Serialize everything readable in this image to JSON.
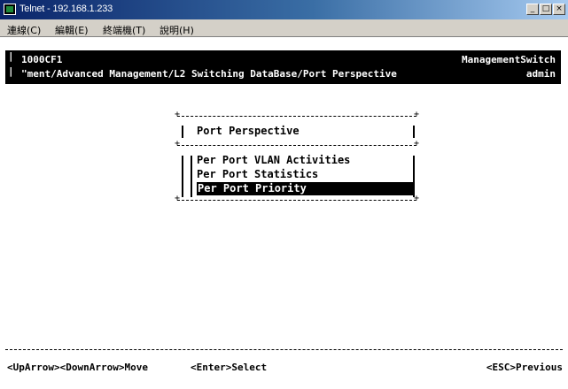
{
  "window": {
    "title": "Telnet - 192.168.1.233",
    "controls": [
      "_",
      "□",
      "×"
    ]
  },
  "menubar": {
    "items": [
      "連線(C)",
      "編輯(E)",
      "終端機(T)",
      "說明(H)"
    ]
  },
  "terminal": {
    "header": {
      "device_id": "1000CF1",
      "product": "ManagementSwitch",
      "path": "\"ment/Advanced Management/L2 Switching DataBase/Port Perspective",
      "user": "admin"
    },
    "menu": {
      "title": "Port Perspective",
      "options": [
        "Per Port VLAN Activities",
        "Per Port Statistics",
        "Per Port Priority"
      ],
      "selected_index": 2
    },
    "footer": {
      "navigation": "<UpArrow><DownArrow>Move",
      "select": "<Enter>Select",
      "previous": "<ESC>Previous"
    }
  }
}
